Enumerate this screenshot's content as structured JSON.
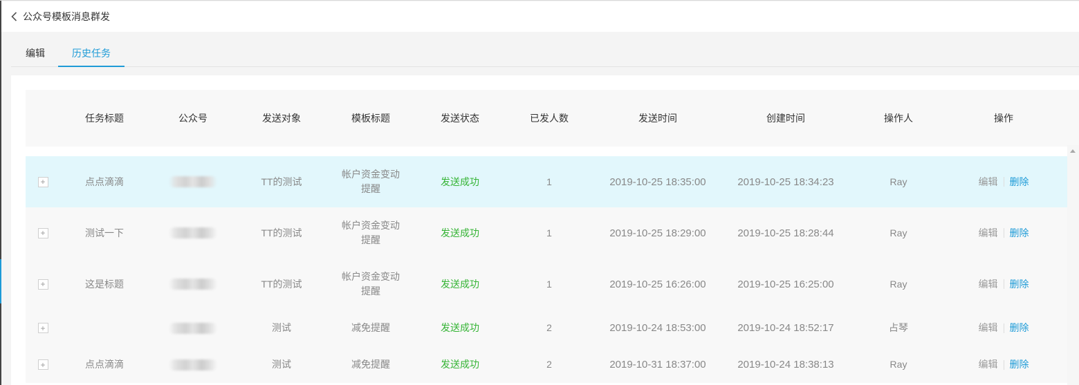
{
  "header": {
    "title": "公众号模板消息群发"
  },
  "tabs": [
    {
      "label": "编辑",
      "active": false
    },
    {
      "label": "历史任务",
      "active": true
    }
  ],
  "table": {
    "columns": [
      "任务标题",
      "公众号",
      "发送对象",
      "模板标题",
      "发送状态",
      "已发人数",
      "发送时间",
      "创建时间",
      "操作人",
      "操作"
    ],
    "rows": [
      {
        "title": "点点滴滴",
        "target": "TT的测试",
        "template": "帐户资金变动提醒",
        "status": "发送成功",
        "count": "1",
        "send_time": "2019-10-25 18:35:00",
        "create_time": "2019-10-25 18:34:23",
        "operator": "Ray"
      },
      {
        "title": "测试一下",
        "target": "TT的测试",
        "template": "帐户资金变动提醒",
        "status": "发送成功",
        "count": "1",
        "send_time": "2019-10-25 18:29:00",
        "create_time": "2019-10-25 18:28:44",
        "operator": "Ray"
      },
      {
        "title": "这是标题",
        "target": "TT的测试",
        "template": "帐户资金变动提醒",
        "status": "发送成功",
        "count": "1",
        "send_time": "2019-10-25 16:26:00",
        "create_time": "2019-10-25 16:25:00",
        "operator": "Ray"
      },
      {
        "title": "",
        "target": "测试",
        "template": "减免提醒",
        "status": "发送成功",
        "count": "2",
        "send_time": "2019-10-24 18:53:00",
        "create_time": "2019-10-24 18:52:17",
        "operator": "占琴"
      },
      {
        "title": "点点滴滴",
        "target": "测试",
        "template": "减免提醒",
        "status": "发送成功",
        "count": "2",
        "send_time": "2019-10-31 18:37:00",
        "create_time": "2019-10-24 18:38:13",
        "operator": "Ray"
      }
    ],
    "actions": {
      "edit": "编辑",
      "delete": "删除"
    },
    "expand_symbol": "+"
  },
  "colors": {
    "accent": "#1e9bd7",
    "success": "#35b435",
    "hover_row": "#e2f7fc"
  }
}
